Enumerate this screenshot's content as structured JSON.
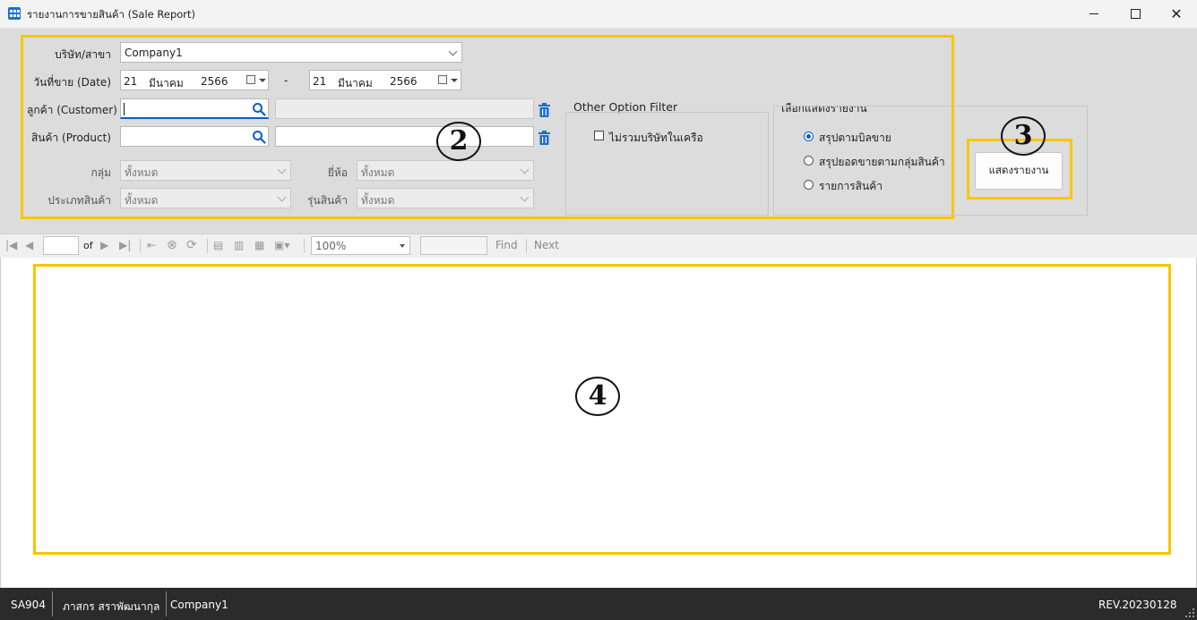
{
  "window": {
    "title": "รายงานการขายสินค้า (Sale Report)",
    "min_icon": "minimize-icon",
    "max_icon": "maximize-icon",
    "close_icon": "close-icon"
  },
  "filters": {
    "company_label": "บริษัท/สาขา",
    "company_value": "Company1",
    "date_label": "วันที่ขาย (Date)",
    "date_from": {
      "day": "21",
      "month": "มีนาคม",
      "year": "2566"
    },
    "date_sep": "-",
    "date_to": {
      "day": "21",
      "month": "มีนาคม",
      "year": "2566"
    },
    "customer_label": "ลูกค้า (Customer)",
    "customer_value": "",
    "customer_name": "",
    "product_label": "สินค้า (Product)",
    "product_value": "",
    "product_name": "",
    "group_label": "กลุ่ม",
    "group_value": "ทั้งหมด",
    "brand_label": "ยี่ห้อ",
    "brand_value": "ทั้งหมด",
    "type_label": "ประเภทสินค้า",
    "type_value": "ทั้งหมด",
    "model_label": "รุ่นสินค้า",
    "model_value": "ทั้งหมด"
  },
  "other_option": {
    "title": "Other Option Filter",
    "exclude_affiliates_label": "ไม่รวมบริษัทในเครือ",
    "exclude_affiliates_checked": false
  },
  "report_select": {
    "title": "เลือกแสดงรายงาน",
    "options": [
      "สรุปตามบิลขาย",
      "สรุปยอดขายตามกลุ่มสินค้า",
      "รายการสินค้า"
    ],
    "selected": 0
  },
  "show_button_label": "แสดงรายงาน",
  "markers": {
    "m2": "2",
    "m3": "3",
    "m4": "4"
  },
  "toolbar": {
    "page_value": "",
    "of_label": "of",
    "zoom_value": "100%",
    "find_value": "",
    "find_label": "Find",
    "next_label": "Next"
  },
  "status": {
    "code": "SA904",
    "user": "ภาสกร สราพัฒนากุล",
    "company": "Company1",
    "revision": "REV.20230128"
  },
  "colors": {
    "highlight": "#f7c600",
    "accent": "#0a5fbf",
    "statusbar": "#2b2b2b"
  }
}
